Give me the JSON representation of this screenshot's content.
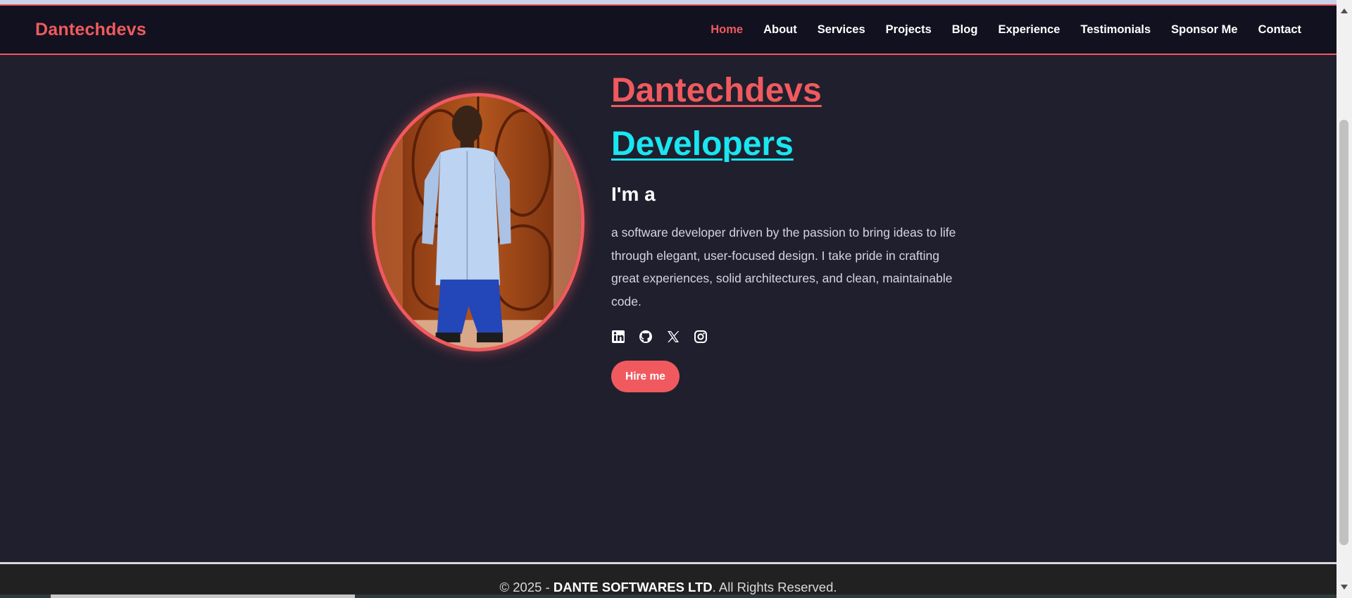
{
  "header": {
    "brand": "Dantechdevs",
    "nav": [
      {
        "label": "Home",
        "active": true
      },
      {
        "label": "About"
      },
      {
        "label": "Services"
      },
      {
        "label": "Projects"
      },
      {
        "label": "Blog"
      },
      {
        "label": "Experience"
      },
      {
        "label": "Testimonials"
      },
      {
        "label": "Sponsor Me"
      },
      {
        "label": "Contact"
      }
    ]
  },
  "hero": {
    "title_line1": "Dantechdevs",
    "title_line2": "Developers",
    "subtitle": "I'm a",
    "bio": "a software developer driven by the passion to bring ideas to life through elegant, user-focused design. I take pride in crafting great experiences, solid architectures, and clean, maintainable code.",
    "socials": [
      "linkedin-icon",
      "github-icon",
      "x-icon",
      "instagram-icon"
    ],
    "cta_label": "Hire me"
  },
  "footer": {
    "prefix": "© 2025 - ",
    "company": "DANTE SOFTWARES LTD",
    "suffix": ". All Rights Reserved."
  },
  "colors": {
    "accent": "#f05a5e",
    "cyan": "#19e6f0",
    "background": "#201f2e",
    "navbar": "#12111f"
  }
}
